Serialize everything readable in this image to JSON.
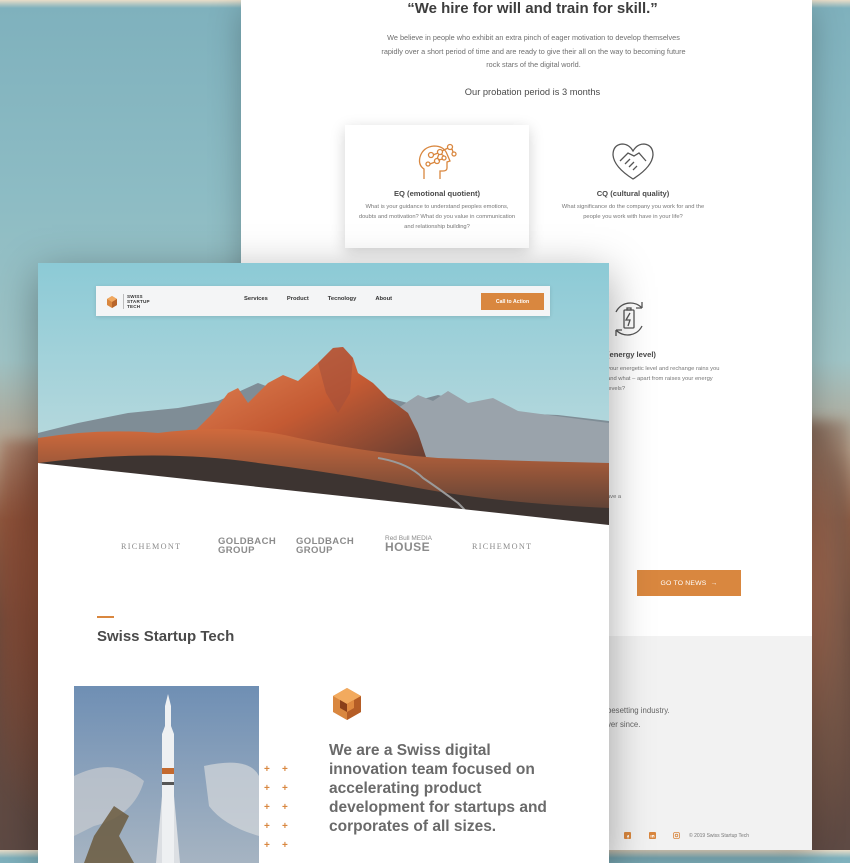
{
  "back_page": {
    "heading": "“We hire for will and train for skill.”",
    "paragraph": "We believe in people who exhibit an extra pinch of eager motivation to develop themselves rapidly over a short period of time and are ready to give their all on the way to becoming future rock stars of the digital world.",
    "probation": "Our probation period is 3 months",
    "features": [
      {
        "title": "EQ (emotional quotient)",
        "description": "What is your guidance to understand peoples emotions, doubts and motivation? What do you value in communication and relationship building?",
        "icon": "brain-network-icon"
      },
      {
        "title": "CQ (cultural quality)",
        "description": "What significance do the company you work for and the people you work with have in your life?",
        "icon": "heart-handshake-icon"
      },
      {
        "title": "(energy level)",
        "description": "your energetic level and rechange rains you and what – apart from raises your energy levels?",
        "icon": "battery-cycle-icon"
      }
    ],
    "leave_fragment": "to leave a",
    "news_button": "GO TO NEWS",
    "footer": {
      "line1": "besetting industry.",
      "line2": "ver since.",
      "copyright": "© 2019 Swiss Startup Tech",
      "social_icons": [
        "facebook-icon",
        "linkedin-icon",
        "instagram-icon"
      ]
    }
  },
  "front_page": {
    "logo_text": "SWISS\nSTARTUP\nTECH",
    "nav": {
      "links": [
        "Services",
        "Product",
        "Tecnology",
        "About"
      ],
      "cta": "Call to Action"
    },
    "client_logos": [
      {
        "line1": "RICHEMONT",
        "line2": ""
      },
      {
        "line1": "GOLDBACH",
        "line2": "GROUP"
      },
      {
        "line1": "GOLDBACH",
        "line2": "GROUP"
      },
      {
        "line1": "Red Bull MEDIA",
        "line2": "HOUSE"
      },
      {
        "line1": "RICHEMONT",
        "line2": ""
      }
    ],
    "section_title": "Swiss Startup Tech",
    "about_text": "We are a Swiss digital innovation team focused on accelerating product development for startups and corporates of all sizes."
  },
  "colors": {
    "accent": "#d9873f",
    "heading": "#4a4a4a",
    "body": "#6e6e6e"
  }
}
